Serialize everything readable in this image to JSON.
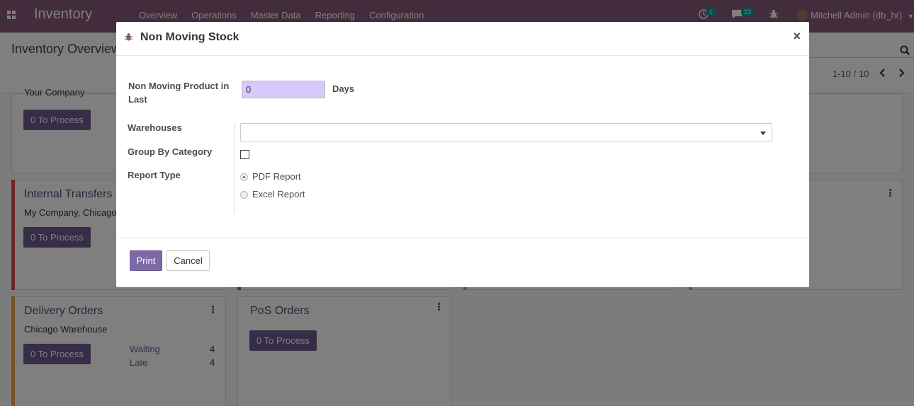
{
  "navbar": {
    "brand": "Inventory",
    "menu": [
      "Overview",
      "Operations",
      "Master Data",
      "Reporting",
      "Configuration"
    ],
    "activity_count": "1",
    "message_count": "23",
    "user": "Mitchell Admin (db_hr)",
    "accent": "#875a7b"
  },
  "control": {
    "title": "Inventory Overview",
    "pager": "1-10 / 10"
  },
  "kanban": {
    "top_card_subtitle": "Your Company",
    "to_process": "0 To Process",
    "internal": {
      "title": "Internal Transfers",
      "subtitle": "My Company, Chicago"
    },
    "delivery": {
      "title": "Delivery Orders",
      "subtitle": "Chicago Warehouse",
      "waiting_label": "Waiting",
      "waiting_value": "4",
      "late_label": "Late",
      "late_value": "4"
    },
    "pos": {
      "title": "PoS Orders"
    }
  },
  "dialog": {
    "title": "Non Moving Stock",
    "days_label": "Non Moving Product in Last",
    "days_value": "0",
    "days_unit": "Days",
    "warehouses_label": "Warehouses",
    "warehouses_value": "",
    "group_by_label": "Group By Category",
    "group_by_checked": false,
    "report_type_label": "Report Type",
    "report_options": [
      "PDF Report",
      "Excel Report"
    ],
    "report_selected": "PDF Report",
    "print_label": "Print",
    "cancel_label": "Cancel",
    "close_label": "×"
  }
}
